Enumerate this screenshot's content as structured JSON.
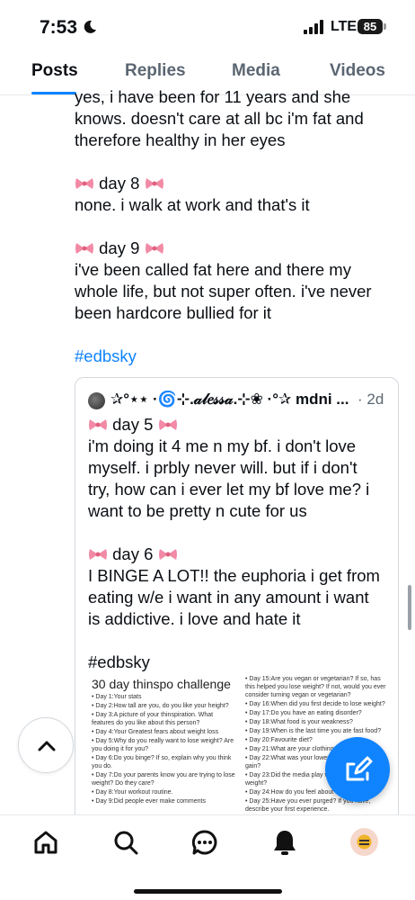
{
  "status_bar": {
    "time": "7:53",
    "network": "LTE",
    "battery": "85"
  },
  "tabs": [
    {
      "label": "Posts",
      "active": true
    },
    {
      "label": "Replies",
      "active": false
    },
    {
      "label": "Media",
      "active": false
    },
    {
      "label": "Videos",
      "active": false
    }
  ],
  "post": {
    "lines_intro": [
      "yes, i have been for 11 years and she",
      "knows. doesn't care at all bc i'm fat and",
      "therefore healthy in her eyes"
    ],
    "day8_heading": "day 8",
    "day8_lines": [
      "none. i walk at work and that's it"
    ],
    "day9_heading": "day 9",
    "day9_lines": [
      "i've been called fat here and there my",
      "whole life, but not super often. i've never",
      "been hardcore bullied for it"
    ],
    "hashtag": "#edbsky"
  },
  "quote": {
    "author": "✰°⋆⋆ ·🌀⊹.𝒶𝓁𝑒𝓈𝓈𝒶.⊹❀ ·°✰ mdni ...",
    "time": "· 2d",
    "day5_heading": "day 5",
    "day5_lines": [
      "i'm doing it 4 me n my bf. i don't love",
      "myself. i prbly never will. but if i don't",
      "try, how can i ever let my bf love me? i",
      "want to be pretty n cute for us"
    ],
    "day6_heading": "day 6",
    "day6_lines": [
      "I BINGE A LOT!! the euphoria i get from",
      "eating w/e i want in any amount i want",
      "is addictive. i love and hate it"
    ],
    "hashtag": "#edbsky",
    "image": {
      "title": "30 day thinspo challenge",
      "left_items": [
        "• Day 1:Your stats",
        "• Day 2:How tall are you, do you like your height?",
        "• Day 3:A picture of your thinspiration. What features do you like about this person?",
        "• Day 4:Your Greatest fears about weight loss",
        "• Day 5:Why do you really want to lose weight? Are you doing it for you?",
        "• Day 6:Do you binge? If so, explain why you think you do.",
        "• Day 7:Do your parents know you are trying to lose weight? Do they care?",
        "• Day 8:Your workout routine.",
        "• Day 9:Did people ever make comments"
      ],
      "right_items": [
        "• Day 15:Are you vegan or vegetarian? If so, has this helped you lose weight? If not, would you ever consider turning vegan or vegetarian?",
        "• Day 16:When did you first decide to lose weight?",
        "• Day 17:Do you have an eating disorder?",
        "• Day 18:What food is your weakness?",
        "• Day 19:When is the last time you ate fast food?",
        "• Day 20:Favourite diet?",
        "• Day 21:What are your clothing",
        "• Day 22:What was your lowest and why did you gain?",
        "• Day 23:Did the media play wanting to lose weight?",
        "• Day 24:How do you feel about ana/pro-mia.",
        "• Day 25:Have you ever purged? If you have, describe your first experience."
      ]
    }
  },
  "colors": {
    "accent": "#1083fe",
    "text": "#0b0f14",
    "muted": "#5b6672",
    "border": "#d4d9de"
  },
  "icons": [
    "moon-icon",
    "signal-icon",
    "bow-icon",
    "chevron-up-icon",
    "compose-icon",
    "home-icon",
    "search-icon",
    "chat-icon",
    "bell-icon"
  ]
}
